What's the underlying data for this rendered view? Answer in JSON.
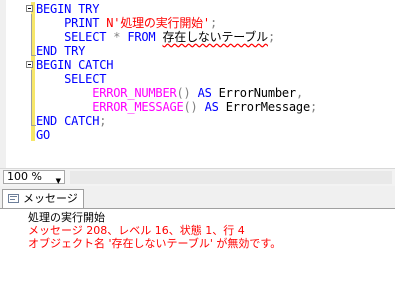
{
  "editor": {
    "lines": [
      [
        {
          "t": "BEGIN TRY",
          "c": "kw"
        }
      ],
      [
        {
          "t": "    ",
          "c": "id"
        },
        {
          "t": "PRINT ",
          "c": "kw"
        },
        {
          "t": "N'処理の実行開始'",
          "c": "str"
        },
        {
          "t": ";",
          "c": "op"
        }
      ],
      [
        {
          "t": "    ",
          "c": "id"
        },
        {
          "t": "SELECT ",
          "c": "kw"
        },
        {
          "t": "* ",
          "c": "op"
        },
        {
          "t": "FROM ",
          "c": "kw"
        },
        {
          "t": "存在しないテーブル",
          "c": "bad"
        },
        {
          "t": ";",
          "c": "op"
        }
      ],
      [
        {
          "t": "END TRY",
          "c": "kw"
        }
      ],
      [
        {
          "t": "BEGIN CATCH",
          "c": "kw"
        }
      ],
      [
        {
          "t": "    ",
          "c": "id"
        },
        {
          "t": "SELECT",
          "c": "kw"
        }
      ],
      [
        {
          "t": "        ",
          "c": "id"
        },
        {
          "t": "ERROR_NUMBER",
          "c": "fn"
        },
        {
          "t": "() ",
          "c": "op"
        },
        {
          "t": "AS ",
          "c": "kw"
        },
        {
          "t": "ErrorNumber",
          "c": "id"
        },
        {
          "t": ",",
          "c": "op"
        }
      ],
      [
        {
          "t": "        ",
          "c": "id"
        },
        {
          "t": "ERROR_MESSAGE",
          "c": "fn"
        },
        {
          "t": "() ",
          "c": "op"
        },
        {
          "t": "AS ",
          "c": "kw"
        },
        {
          "t": "ErrorMessage",
          "c": "id"
        },
        {
          "t": ";",
          "c": "op"
        }
      ],
      [
        {
          "t": "END CATCH",
          "c": "kw"
        },
        {
          "t": ";",
          "c": "op"
        }
      ],
      [
        {
          "t": "GO",
          "c": "kw"
        }
      ]
    ]
  },
  "zoom": {
    "value": "100 %"
  },
  "results": {
    "tab_label": "メッセージ",
    "messages": [
      {
        "text": "処理の実行開始",
        "kind": "ok"
      },
      {
        "text": "メッセージ 208、レベル 16、状態 1、行 4",
        "kind": "err"
      },
      {
        "text": "オブジェクト名 '存在しないテーブル' が無効です。",
        "kind": "err"
      }
    ]
  },
  "colors": {
    "keyword": "#0000ff",
    "string": "#ff0000",
    "function": "#ff00ff",
    "operator": "#808080",
    "error": "#ff0000"
  }
}
